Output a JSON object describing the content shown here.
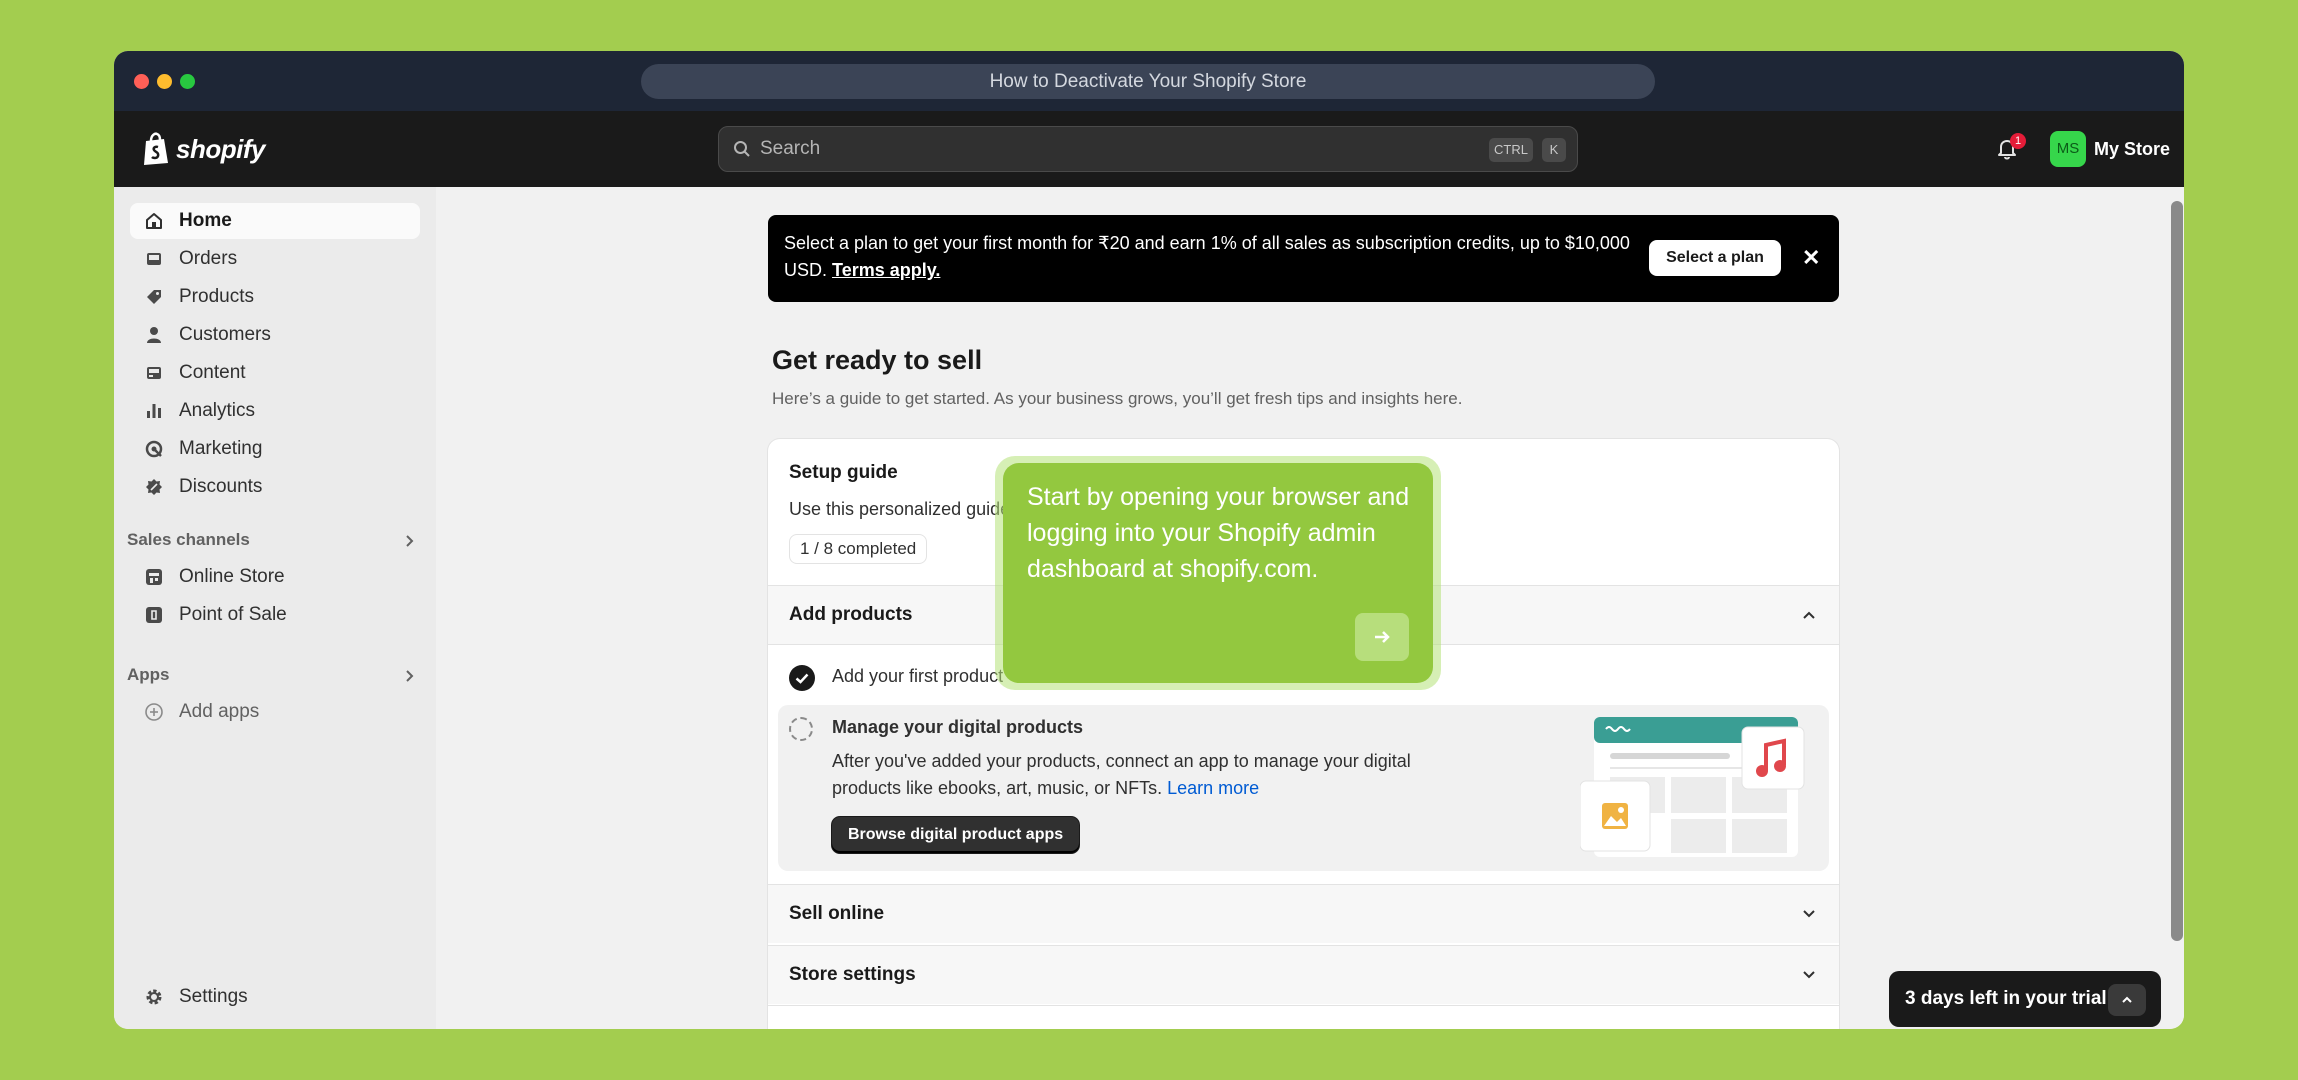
{
  "browser": {
    "title": "How to Deactivate Your Shopify Store"
  },
  "topbar": {
    "logo_text": "shopify",
    "search_placeholder": "Search",
    "shortcut_ctrl": "CTRL",
    "shortcut_key": "K",
    "notification_count": "1",
    "avatar_initials": "MS",
    "store_name": "My Store"
  },
  "sidebar": {
    "items": [
      {
        "label": "Home",
        "icon": "home-icon"
      },
      {
        "label": "Orders",
        "icon": "inbox-icon"
      },
      {
        "label": "Products",
        "icon": "tag-icon"
      },
      {
        "label": "Customers",
        "icon": "person-icon"
      },
      {
        "label": "Content",
        "icon": "image-icon"
      },
      {
        "label": "Analytics",
        "icon": "bar-chart-icon"
      },
      {
        "label": "Marketing",
        "icon": "target-icon"
      },
      {
        "label": "Discounts",
        "icon": "discount-icon"
      }
    ],
    "sales_channels_title": "Sales channels",
    "channels": [
      {
        "label": "Online Store",
        "icon": "store-icon"
      },
      {
        "label": "Point of Sale",
        "icon": "pos-icon"
      }
    ],
    "apps_title": "Apps",
    "add_apps": "Add apps",
    "settings": "Settings"
  },
  "banner": {
    "text": "Select a plan to get your first month for ₹20 and earn 1% of all sales as subscription credits, up to $10,000 USD.",
    "link": "Terms apply.",
    "button": "Select a plan",
    "close": "✕"
  },
  "page": {
    "title": "Get ready to sell",
    "subtitle": "Here’s a guide to get started. As your business grows, you’ll get fresh tips and insights here."
  },
  "setup": {
    "title": "Setup guide",
    "description": "Use this personalized guide",
    "progress": "1 / 8 completed",
    "sections": {
      "add_products": "Add products",
      "sell_online": "Sell online",
      "store_settings": "Store settings"
    },
    "task_done": "Add your first product",
    "task_title": "Manage your digital products",
    "task_body": "After you've added your products, connect an app to manage your digital products like ebooks, art, music, or NFTs.",
    "learn_more": "Learn more",
    "browse_button": "Browse digital product apps"
  },
  "tooltip": {
    "text": "Start by opening your browser and logging into your Shopify admin dashboard at shopify.com."
  },
  "trial": {
    "text": "3 days left in your trial"
  },
  "colors": {
    "background": "#a3cd4f",
    "tooltip": "#93c83f",
    "link": "#005bd3"
  }
}
